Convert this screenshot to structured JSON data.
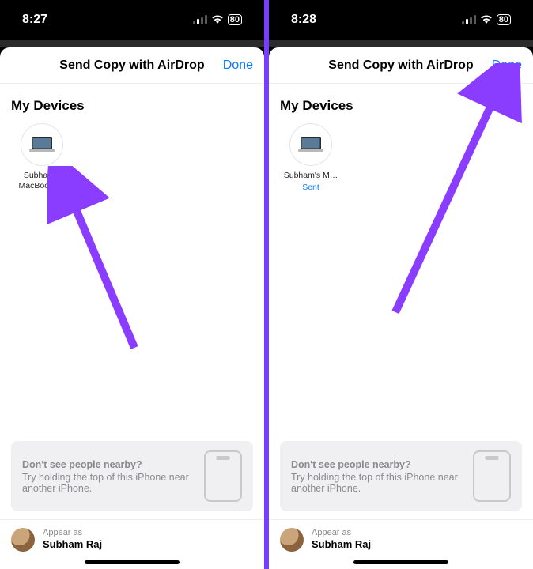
{
  "left": {
    "time": "8:27",
    "battery": "80",
    "sheet_title": "Send Copy with AirDrop",
    "done": "Done",
    "section": "My Devices",
    "device_name": "Subham's MacBook Air",
    "device_status": "",
    "tip_title": "Don't see people nearby?",
    "tip_body": "Try holding the top of this iPhone near another iPhone.",
    "appear_label": "Appear as",
    "appear_name": "Subham Raj"
  },
  "right": {
    "time": "8:28",
    "battery": "80",
    "sheet_title": "Send Copy with AirDrop",
    "done": "Done",
    "section": "My Devices",
    "device_name": "Subham's M…",
    "device_status": "Sent",
    "tip_title": "Don't see people nearby?",
    "tip_body": "Try holding the top of this iPhone near another iPhone.",
    "appear_label": "Appear as",
    "appear_name": "Subham Raj"
  }
}
